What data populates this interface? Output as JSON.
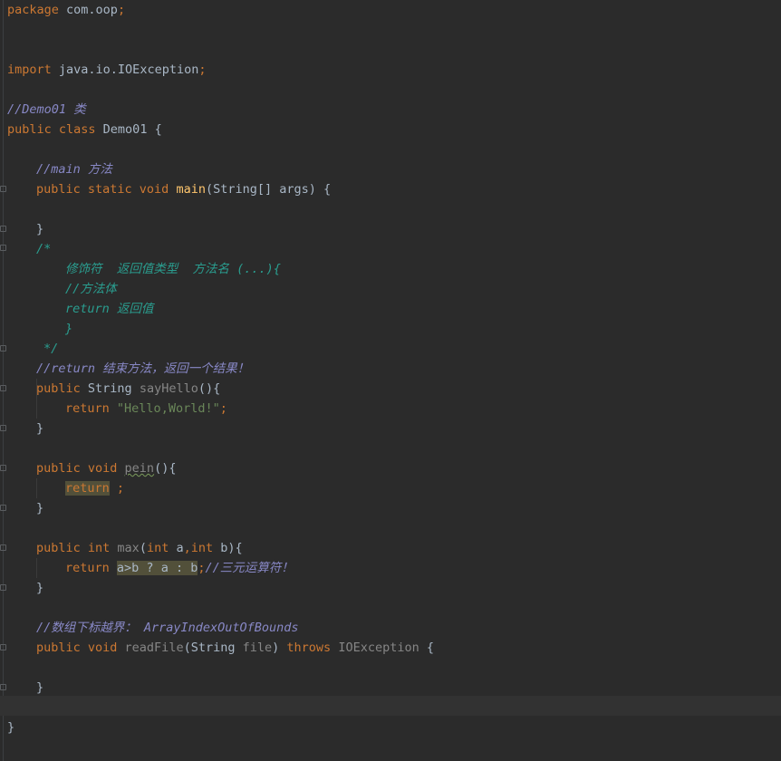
{
  "code": {
    "l1": "package",
    "l1b": " com.oop",
    "l1c": ";",
    "l2": "import",
    "l2b": " java.io.IOException",
    "l2c": ";",
    "c1": "//Demo01 类",
    "l3a": "public class",
    "l3b": " Demo01 {",
    "c2": "//main 方法",
    "l4a": "public static void",
    "l4b": " ",
    "l4fn": "main",
    "l4c": "(String[] args) {",
    "l5": "}",
    "b1": "/*",
    "b2": "修饰符  返回值类型  方法名 (...){",
    "b3": "//方法体",
    "b4": "return 返回值",
    "b5": "}",
    "b6": "*/",
    "c3": "//return 结束方法，返回一个结果！",
    "l6a": "public",
    "l6b": " String ",
    "l6fn": "sayHello",
    "l6c": "(){",
    "l7a": "return",
    "l7b": " ",
    "l7s": "\"Hello,World!\"",
    "l7c": ";",
    "l8": "}",
    "l9a": "public void",
    "l9b": " ",
    "l9fn": "pein",
    "l9c": "(){",
    "l10a": "return",
    "l10b": " ;",
    "l11": "}",
    "l12a": "public int",
    "l12b": " ",
    "l12fn": "max",
    "l12c": "(",
    "l12d": "int",
    "l12e": " a",
    "l12f": ",",
    "l12g": "int",
    "l12h": " b){",
    "l13a": "return",
    "l13b": " ",
    "l13c": "a>b ? a : b",
    "l13d": ";",
    "l13e": "//三元运算符！",
    "l14": "}",
    "c4": "//数组下标越界： ArrayIndexOutOfBounds",
    "l15a": "public void",
    "l15b": " ",
    "l15fn": "readFile",
    "l15c": "(String ",
    "l15d": "file",
    "l15e": ") ",
    "l15f": "throws",
    "l15g": " ",
    "l15h": "IOException",
    "l15i": " {",
    "l16": "}",
    "l17": "}"
  },
  "colors": {
    "background": "#2b2b2b",
    "keyword": "#cc7832",
    "text": "#a9b7c6",
    "line_comment": "#8888c6",
    "doc_comment": "#2a9d8f",
    "string": "#6a8759",
    "function": "#ffc66d",
    "unused": "#868686"
  }
}
